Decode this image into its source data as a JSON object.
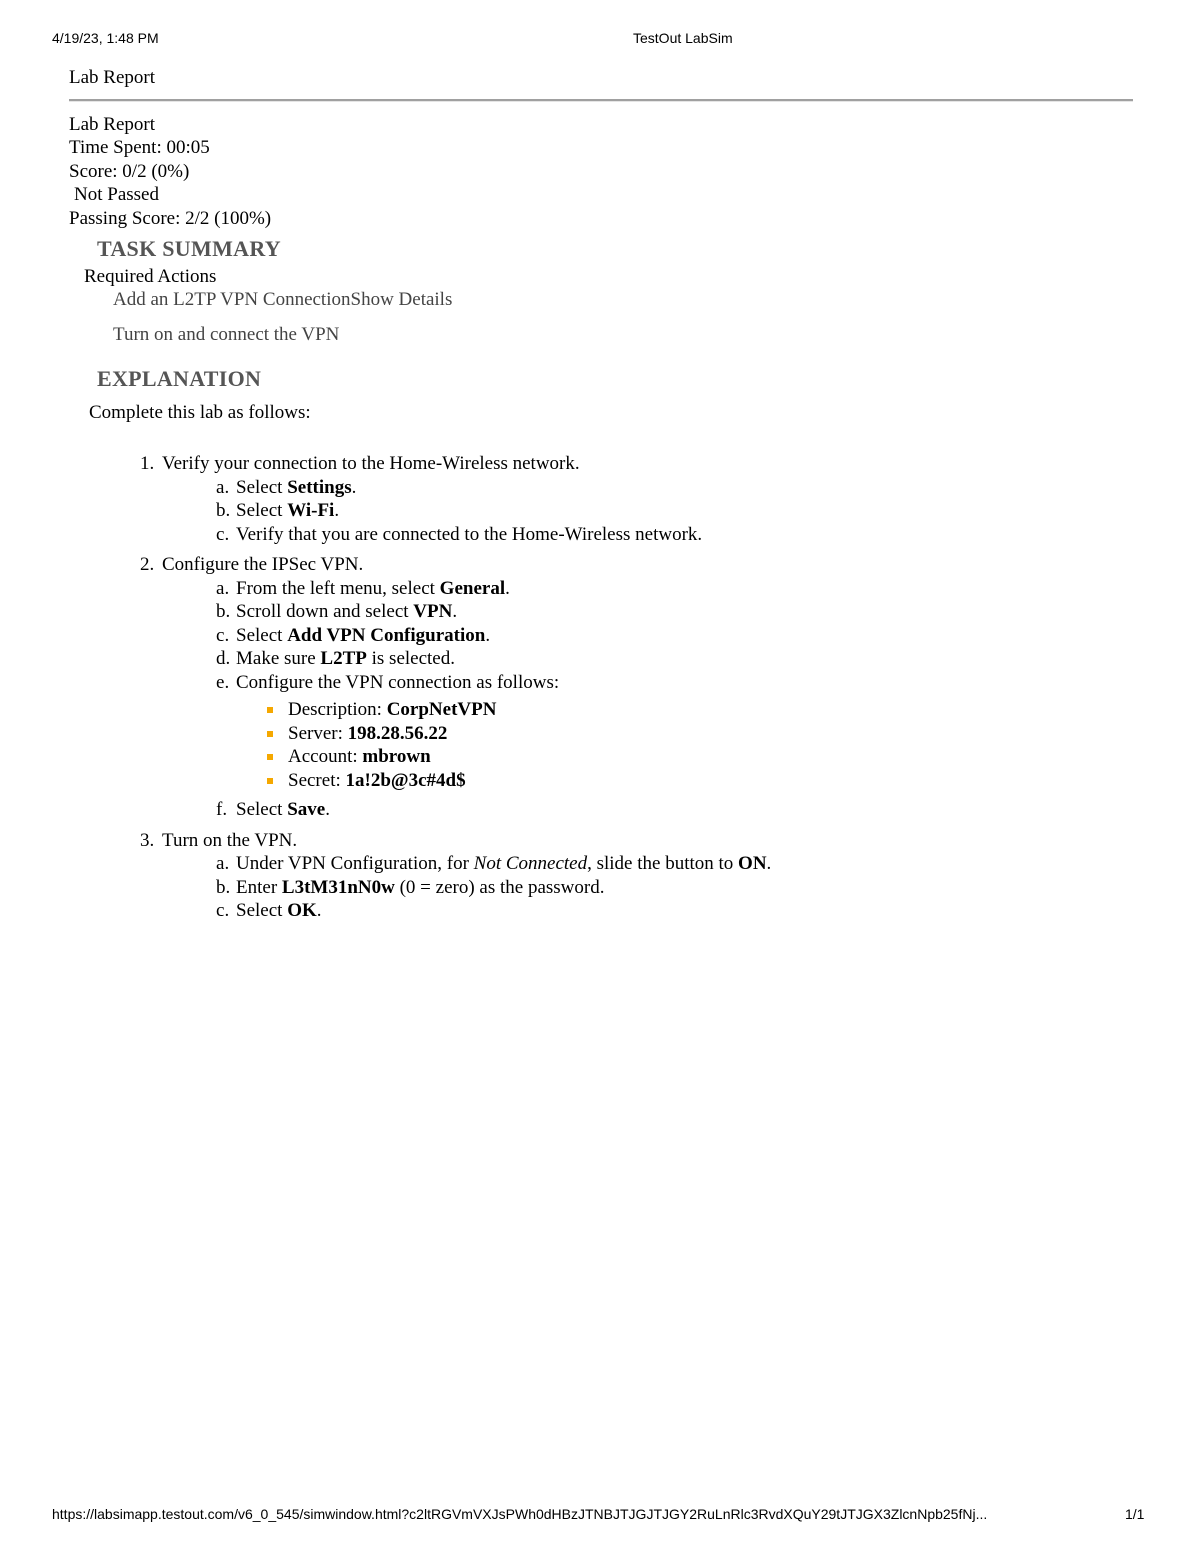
{
  "header": {
    "date": "4/19/23, 1:48 PM",
    "title": "TestOut LabSim"
  },
  "footer": {
    "url": "https://labsimapp.testout.com/v6_0_545/simwindow.html?c2ltRGVmVXJsPWh0dHBzJTNBJTJGJTJGY2RuLnRlc3RvdXQuY29tJTJGX3ZlcnNpb25fNj...",
    "page": "1/1"
  },
  "report": {
    "title": "Lab Report",
    "subtitle": "Lab Report",
    "time_spent": "Time Spent: 00:05",
    "score": "Score: 0/2 (0%)",
    "status": "Not Passed",
    "passing_score": "Passing Score: 2/2 (100%)"
  },
  "task_summary": {
    "heading": "TASK SUMMARY",
    "required_label": "Required Actions",
    "task1": "Add an L2TP VPN Connection",
    "task1_link": "Show Details",
    "task2": "Turn on and connect the VPN"
  },
  "explanation": {
    "heading": "EXPLANATION",
    "intro": "Complete this lab as follows:",
    "s1": "Verify your connection to the Home-Wireless network.",
    "s1a_pre": "Select ",
    "s1a_b": "Settings",
    "s1a_post": ".",
    "s1b_pre": "Select ",
    "s1b_b": "Wi-Fi",
    "s1b_post": ".",
    "s1c": "Verify that you are connected to the Home-Wireless network.",
    "s2": "Configure the IPSec VPN.",
    "s2a_pre": "From the left menu, select ",
    "s2a_b": "General",
    "s2a_post": ".",
    "s2b_pre": "Scroll down and select ",
    "s2b_b": "VPN",
    "s2b_post": ".",
    "s2c_pre": "Select ",
    "s2c_b": "Add VPN Configuration",
    "s2c_post": ".",
    "s2d_pre": "Make sure ",
    "s2d_b": "L2TP",
    "s2d_post": " is selected.",
    "s2e": "Configure the VPN connection as follows:",
    "desc_pre": "Description: ",
    "desc_b": "CorpNetVPN",
    "server_pre": "Server: ",
    "server_b": "198.28.56.22",
    "account_pre": "Account: ",
    "account_b": "mbrown",
    "secret_pre": "Secret: ",
    "secret_b": "1a!2b@3c#4d$",
    "s2f_pre": "Select ",
    "s2f_b": "Save",
    "s2f_post": ".",
    "s3": "Turn on the VPN.",
    "s3a_pre": "Under VPN Configuration, for ",
    "s3a_i": "Not Connected",
    "s3a_mid": ", slide the button to ",
    "s3a_b": "ON",
    "s3a_post": ".",
    "s3b_pre": "Enter ",
    "s3b_b": "L3tM31nN0w",
    "s3b_post": " (0 = zero) as the password.",
    "s3c_pre": "Select ",
    "s3c_b": "OK",
    "s3c_post": "."
  }
}
